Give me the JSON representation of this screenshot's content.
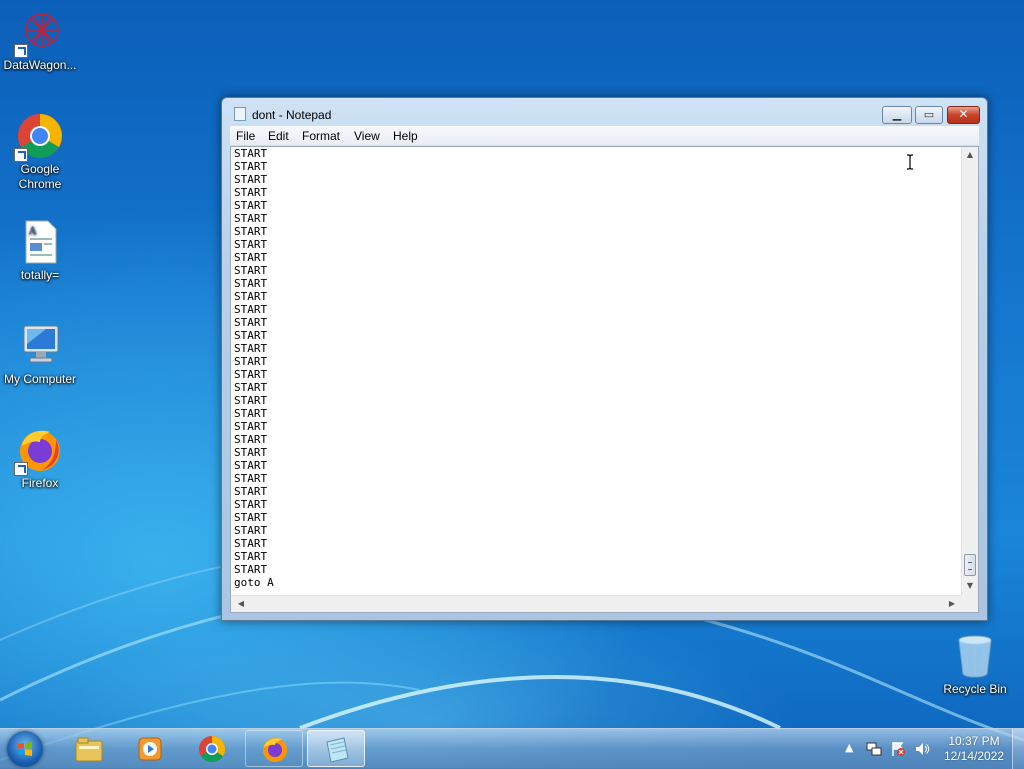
{
  "desktop": {
    "icons": [
      {
        "label": "DataWagon...",
        "icon": "datawagon-icon"
      },
      {
        "label": "Google Chrome",
        "icon": "chrome-icon"
      },
      {
        "label": "totally=",
        "icon": "document-icon"
      },
      {
        "label": "My Computer",
        "icon": "computer-icon"
      },
      {
        "label": "Firefox",
        "icon": "firefox-icon"
      },
      {
        "label": "Recycle Bin",
        "icon": "recycle-bin-icon"
      }
    ]
  },
  "window": {
    "title": "dont - Notepad",
    "controls": {
      "minimize": "▁",
      "maximize": "▭",
      "close": "✕"
    },
    "menu": [
      "File",
      "Edit",
      "Format",
      "View",
      "Help"
    ],
    "lines": [
      "START",
      "START",
      "START",
      "START",
      "START",
      "START",
      "START",
      "START",
      "START",
      "START",
      "START",
      "START",
      "START",
      "START",
      "START",
      "START",
      "START",
      "START",
      "START",
      "START",
      "START",
      "START",
      "START",
      "START",
      "START",
      "START",
      "START",
      "START",
      "START",
      "START",
      "START",
      "START",
      "START",
      "goto A"
    ]
  },
  "taskbar": {
    "apps": [
      "windows-explorer-icon",
      "media-player-icon",
      "chrome-icon",
      "firefox-icon",
      "notepad-icon"
    ],
    "active_app": "notepad-icon",
    "clock": {
      "time": "10:37 PM",
      "date": "12/14/2022"
    },
    "tray": [
      "show-hidden-icons",
      "network-icon",
      "action-center-icon",
      "volume-icon"
    ]
  },
  "colors": {
    "accent": "#1a86d8",
    "close_button": "#c8442a"
  }
}
